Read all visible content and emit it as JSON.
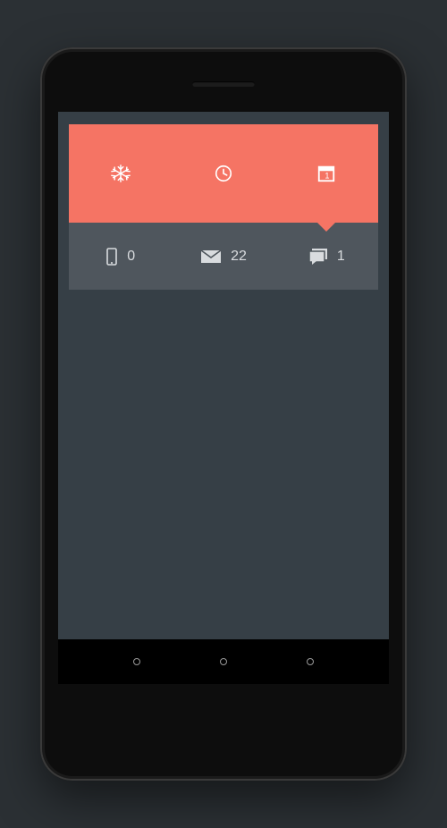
{
  "widget": {
    "tabs": [
      {
        "icon": "snowflake-icon"
      },
      {
        "icon": "clock-icon"
      },
      {
        "icon": "calendar-icon",
        "badge": "1"
      }
    ],
    "active_tab_index": 2,
    "counters": {
      "calls": {
        "icon": "phone-icon",
        "value": "0"
      },
      "mail": {
        "icon": "mail-icon",
        "value": "22"
      },
      "messages": {
        "icon": "message-icon",
        "value": "1"
      }
    }
  },
  "navbar": {
    "buttons": [
      "back",
      "home",
      "recent"
    ]
  }
}
